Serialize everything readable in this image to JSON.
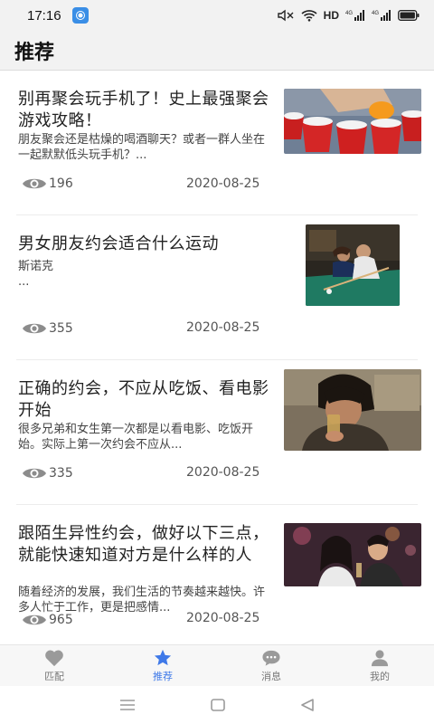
{
  "status_bar": {
    "time": "17:16",
    "network_label": "HD",
    "icons": [
      "app-notification-icon",
      "mute-icon",
      "wifi-icon",
      "signal-icon",
      "signal-icon-2",
      "battery-icon"
    ]
  },
  "header": {
    "title": "推荐"
  },
  "articles": [
    {
      "title": "别再聚会玩手机了！史上最强聚会游戏攻略！",
      "summary": "朋友聚会还是枯燥的喝酒聊天？或者一群人坐在一起默默低头玩手机？...",
      "views": "196",
      "date": "2020-08-25",
      "image": "beer-pong-cups"
    },
    {
      "title": "男女朋友约会适合什么运动",
      "summary": "斯诺克\n...",
      "views": "355",
      "date": "2020-08-25",
      "image": "couple-playing-billiards"
    },
    {
      "title": "正确的约会，不应从吃饭、看电影开始",
      "summary": "很多兄弟和女生第一次都是以看电影、吃饭开始。实际上第一次约会不应从...",
      "views": "335",
      "date": "2020-08-25",
      "image": "man-drinking"
    },
    {
      "title": "跟陌生异性约会，做好以下三点，就能快速知道对方是什么样的人",
      "summary": "随着经济的发展，我们生活的节奏越来越快。许多人忙于工作，更是把感情...",
      "views": "965",
      "date": "2020-08-25",
      "image": "couple-at-bar"
    }
  ],
  "bottom_nav": {
    "items": [
      {
        "label": "匹配",
        "icon": "heart-icon",
        "active": false
      },
      {
        "label": "推荐",
        "icon": "star-icon",
        "active": true
      },
      {
        "label": "消息",
        "icon": "chat-icon",
        "active": false
      },
      {
        "label": "我的",
        "icon": "user-icon",
        "active": false
      }
    ]
  },
  "colors": {
    "accent": "#3f79e8",
    "inactive": "#9a9a9a",
    "background": "#ffffff",
    "header_bg": "#f2f2f2"
  }
}
